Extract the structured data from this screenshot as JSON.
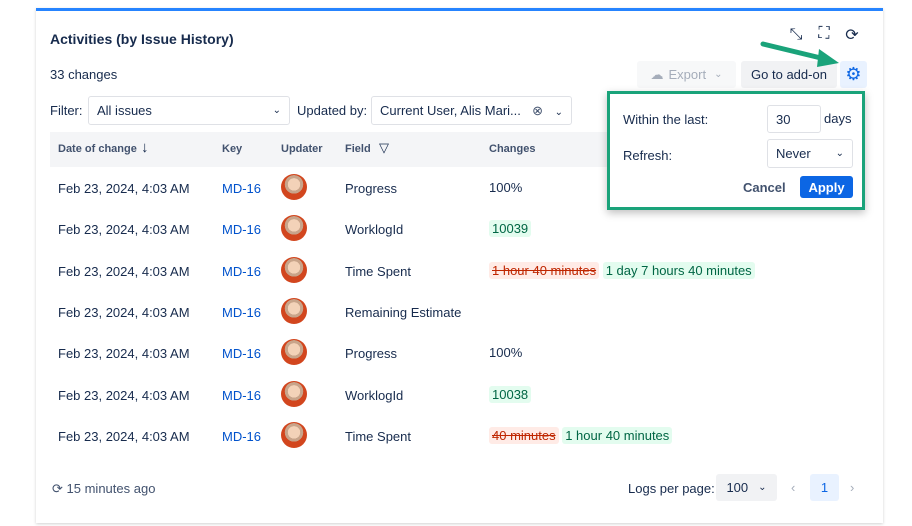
{
  "title": "Activities (by Issue History)",
  "changes_count": "33 changes",
  "toolbar": {
    "export": "Export",
    "goto": "Go to add-on"
  },
  "filter": {
    "label": "Filter:",
    "value": "All issues",
    "updated_by_label": "Updated by:",
    "updated_by_value": "Current User, Alis Mari..."
  },
  "columns": {
    "date": "Date of change",
    "key": "Key",
    "updater": "Updater",
    "field": "Field",
    "changes": "Changes"
  },
  "rows": [
    {
      "date": "Feb 23, 2024, 4:03 AM",
      "key": "MD-16",
      "field": "Progress",
      "plain": "100%"
    },
    {
      "date": "Feb 23, 2024, 4:03 AM",
      "key": "MD-16",
      "field": "WorklogId",
      "new": "10039"
    },
    {
      "date": "Feb 23, 2024, 4:03 AM",
      "key": "MD-16",
      "field": "Time Spent",
      "old": "1 hour 40 minutes",
      "new": "1 day 7 hours 40 minutes"
    },
    {
      "date": "Feb 23, 2024, 4:03 AM",
      "key": "MD-16",
      "field": "Remaining Estimate"
    },
    {
      "date": "Feb 23, 2024, 4:03 AM",
      "key": "MD-16",
      "field": "Progress",
      "plain": "100%"
    },
    {
      "date": "Feb 23, 2024, 4:03 AM",
      "key": "MD-16",
      "field": "WorklogId",
      "new": "10038"
    },
    {
      "date": "Feb 23, 2024, 4:03 AM",
      "key": "MD-16",
      "field": "Time Spent",
      "old": "40 minutes",
      "new": "1 hour 40 minutes"
    }
  ],
  "footer": {
    "refreshed": "15 minutes ago",
    "logs_label": "Logs per page:",
    "logs_value": "100",
    "page": "1"
  },
  "popover": {
    "within_label": "Within the last:",
    "within_value": "30",
    "days": "days",
    "refresh_label": "Refresh:",
    "refresh_value": "Never",
    "cancel": "Cancel",
    "apply": "Apply"
  },
  "colors": {
    "accent": "#0c66e4",
    "highlight": "#1aa37a"
  }
}
